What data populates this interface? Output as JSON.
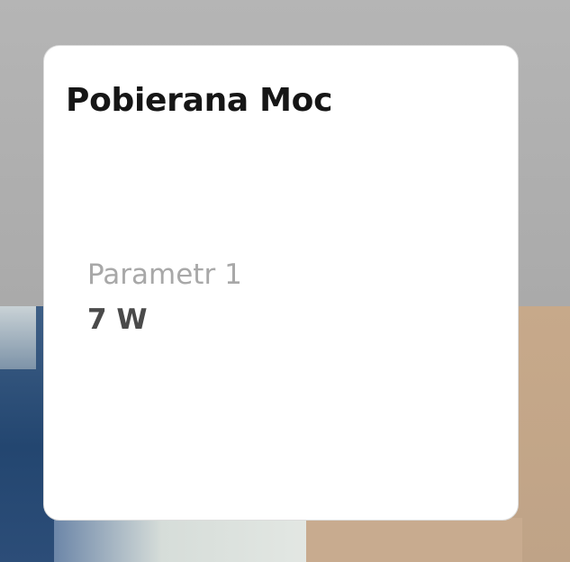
{
  "card": {
    "title": "Pobierana Moc",
    "parameter": {
      "label": "Parametr 1",
      "value": "7 W"
    }
  },
  "colors": {
    "card_background": "#ffffff",
    "title_text": "#161616",
    "label_text": "#a8a8a8",
    "value_text": "#4a4a4a"
  }
}
